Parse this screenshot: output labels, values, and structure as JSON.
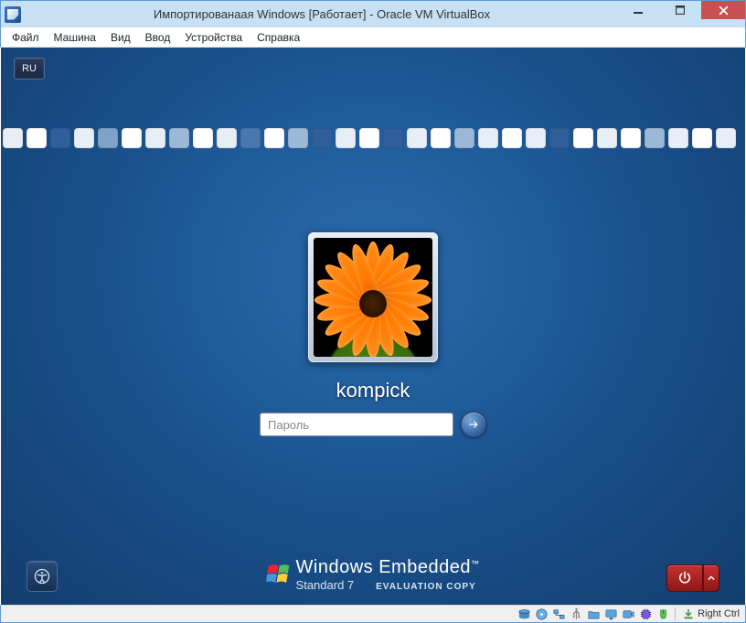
{
  "window": {
    "title": "Импортированаая Windows [Работает] - Oracle VM VirtualBox"
  },
  "menu": {
    "items": [
      "Файл",
      "Машина",
      "Вид",
      "Ввод",
      "Устройства",
      "Справка"
    ]
  },
  "login": {
    "language_indicator": "RU",
    "username": "kompick",
    "password_placeholder": "Пароль",
    "brand_line1": "Windows Embedded",
    "brand_line2": "Standard 7",
    "eval_text": "EVALUATION COPY"
  },
  "statusbar": {
    "host_key": "Right Ctrl"
  },
  "band_colors": [
    "#e8eef5",
    "#ffffff",
    "#2f5f9a",
    "#e8eef5",
    "#7ea2c8",
    "#ffffff",
    "#e8eef5",
    "#9bb8d6",
    "#ffffff",
    "#e8eef5",
    "#4a78ae",
    "#ffffff",
    "#9bb8d6",
    "#2f5f9a",
    "#e8eef5",
    "#ffffff",
    "#2f5f9a",
    "#e8eef5",
    "#ffffff",
    "#9bb8d6",
    "#e8eef5",
    "#ffffff",
    "#e8eef5",
    "#2f5f9a",
    "#ffffff",
    "#e8eef5",
    "#ffffff",
    "#9bb8d6",
    "#e8eef5",
    "#ffffff",
    "#e8eef5"
  ]
}
